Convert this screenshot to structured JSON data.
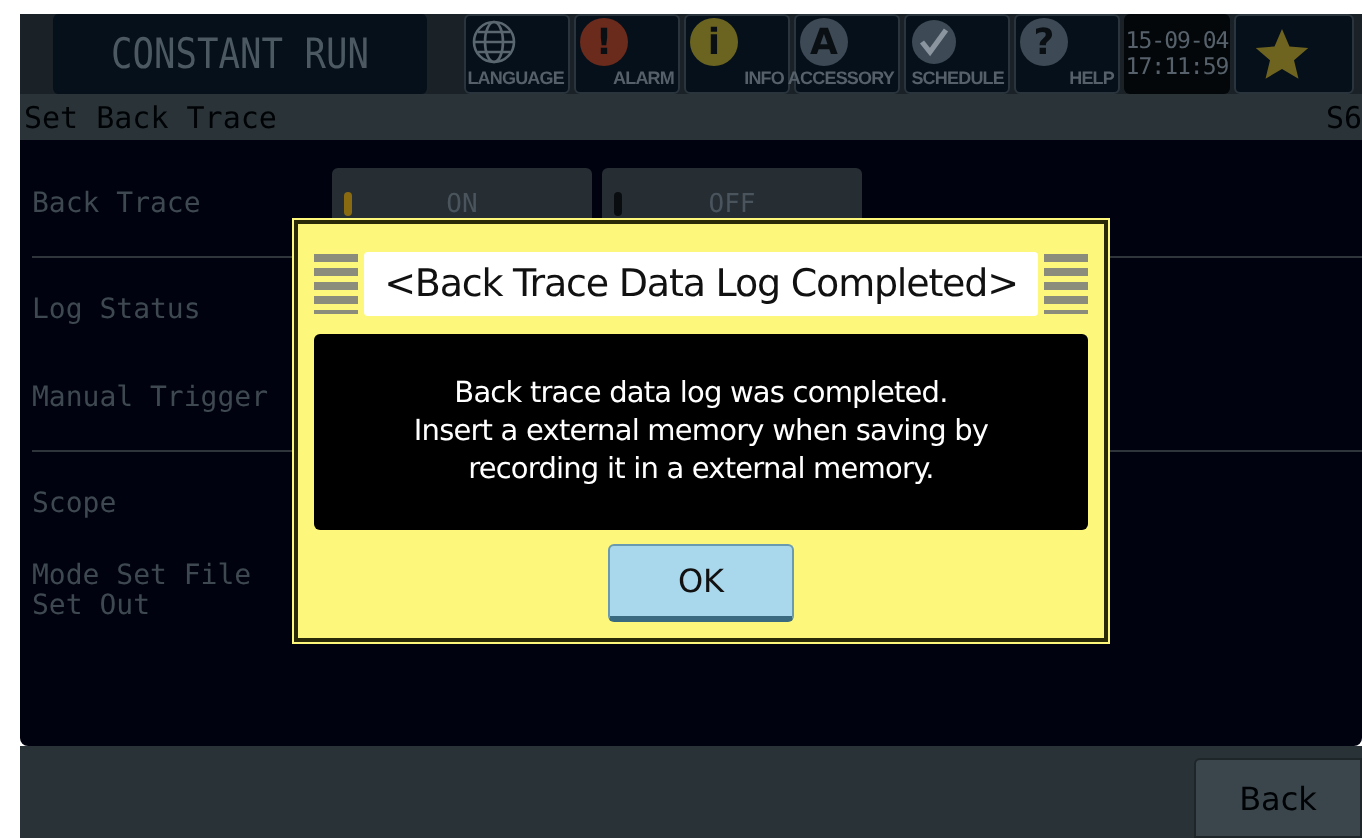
{
  "header": {
    "title": "CONSTANT RUN",
    "buttons": [
      {
        "kind": "language",
        "label": "LANGUAGE"
      },
      {
        "kind": "alarm",
        "label": "ALARM",
        "glyph": "!"
      },
      {
        "kind": "info",
        "label": "INFO",
        "glyph": "i"
      },
      {
        "kind": "accessory",
        "label": "ACCESSORY",
        "glyph": "A"
      },
      {
        "kind": "schedule",
        "label": "SCHEDULE"
      },
      {
        "kind": "help",
        "label": "HELP",
        "glyph": "?"
      }
    ],
    "clock": {
      "date": "15-09-04",
      "time": "17:11:59"
    }
  },
  "screen": {
    "title": "Set Back Trace",
    "code": "S6"
  },
  "rows": [
    {
      "label": "Back Trace",
      "options": [
        {
          "label": "ON",
          "selected": true
        },
        {
          "label": "OFF",
          "selected": false
        }
      ]
    },
    {
      "label": "Log Status"
    },
    {
      "label": "Manual Trigger"
    },
    {
      "label": "Scope"
    },
    {
      "label": "Mode Set File\nSet Out"
    }
  ],
  "dialog": {
    "title": "<Back Trace Data Log Completed>",
    "message": "Back trace data log was completed.\nInsert a external memory when saving by\nrecording it in a external memory.",
    "button": "OK"
  },
  "footer": {
    "button": "Back"
  }
}
